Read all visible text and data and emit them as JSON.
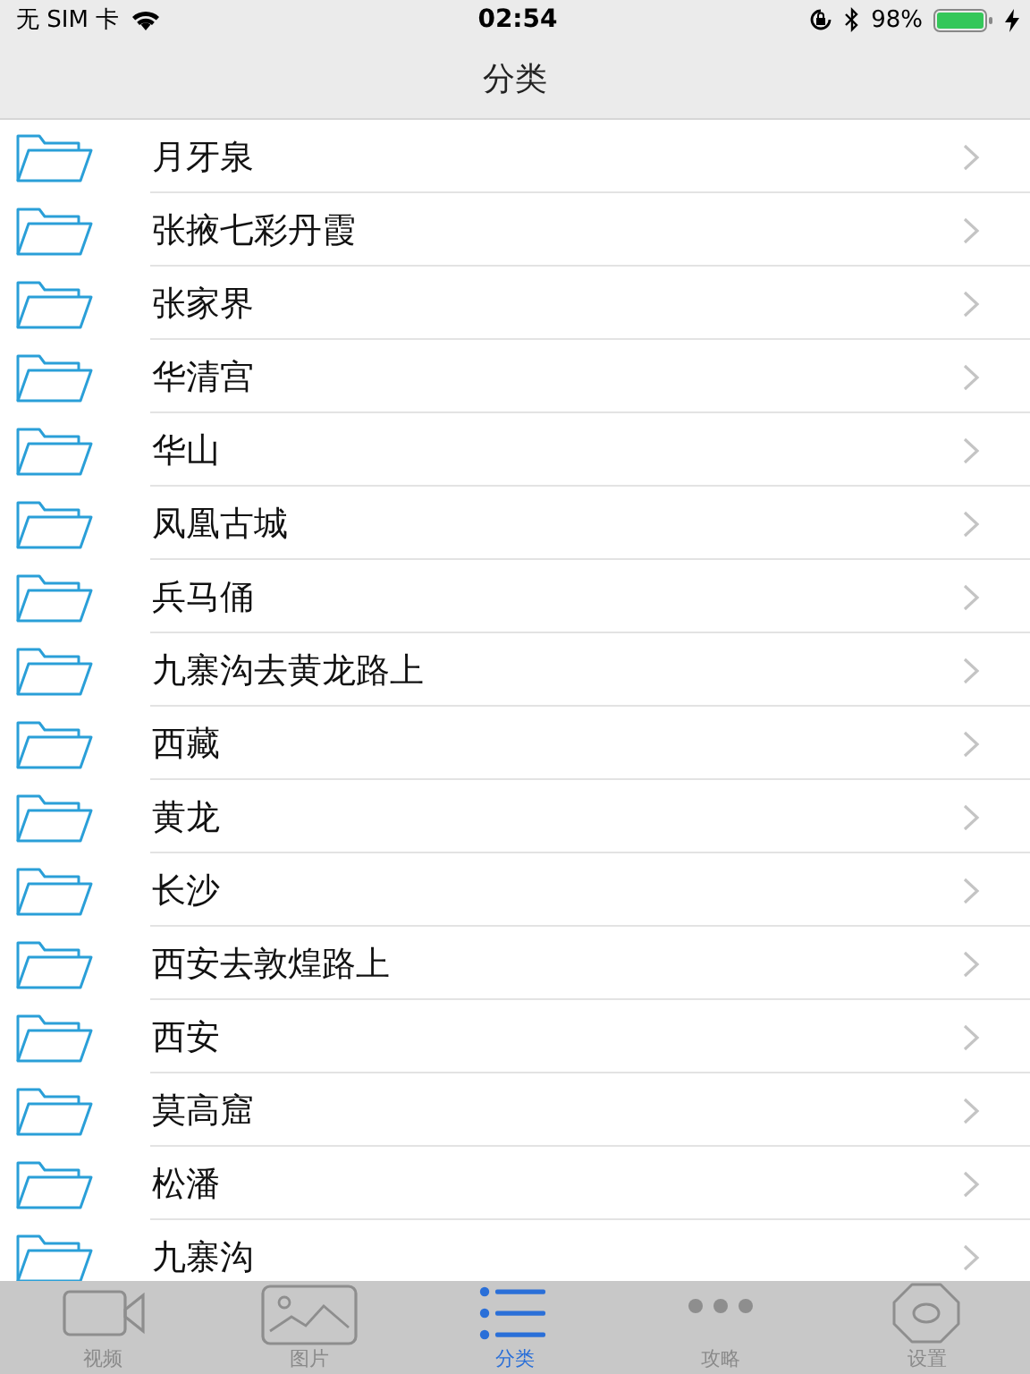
{
  "status_bar": {
    "carrier": "无 SIM 卡",
    "time": "02:54",
    "battery": "98%"
  },
  "nav_bar": {
    "title": "分类"
  },
  "list": {
    "items": [
      {
        "label": "月牙泉"
      },
      {
        "label": "张掖七彩丹霞"
      },
      {
        "label": "张家界"
      },
      {
        "label": "华清宫"
      },
      {
        "label": "华山"
      },
      {
        "label": "凤凰古城"
      },
      {
        "label": "兵马俑"
      },
      {
        "label": "九寨沟去黄龙路上"
      },
      {
        "label": "西藏"
      },
      {
        "label": "黄龙"
      },
      {
        "label": "长沙"
      },
      {
        "label": "西安去敦煌路上"
      },
      {
        "label": "西安"
      },
      {
        "label": "莫高窟"
      },
      {
        "label": "松潘"
      },
      {
        "label": "九寨沟"
      }
    ]
  },
  "tab_bar": {
    "tabs": [
      {
        "kind": "video",
        "label": "视频",
        "selected": false
      },
      {
        "kind": "photo",
        "label": "图片",
        "selected": false
      },
      {
        "kind": "list",
        "label": "分类",
        "selected": true
      },
      {
        "kind": "more",
        "label": "攻略",
        "selected": false
      },
      {
        "kind": "settings",
        "label": "设置",
        "selected": false
      }
    ]
  }
}
